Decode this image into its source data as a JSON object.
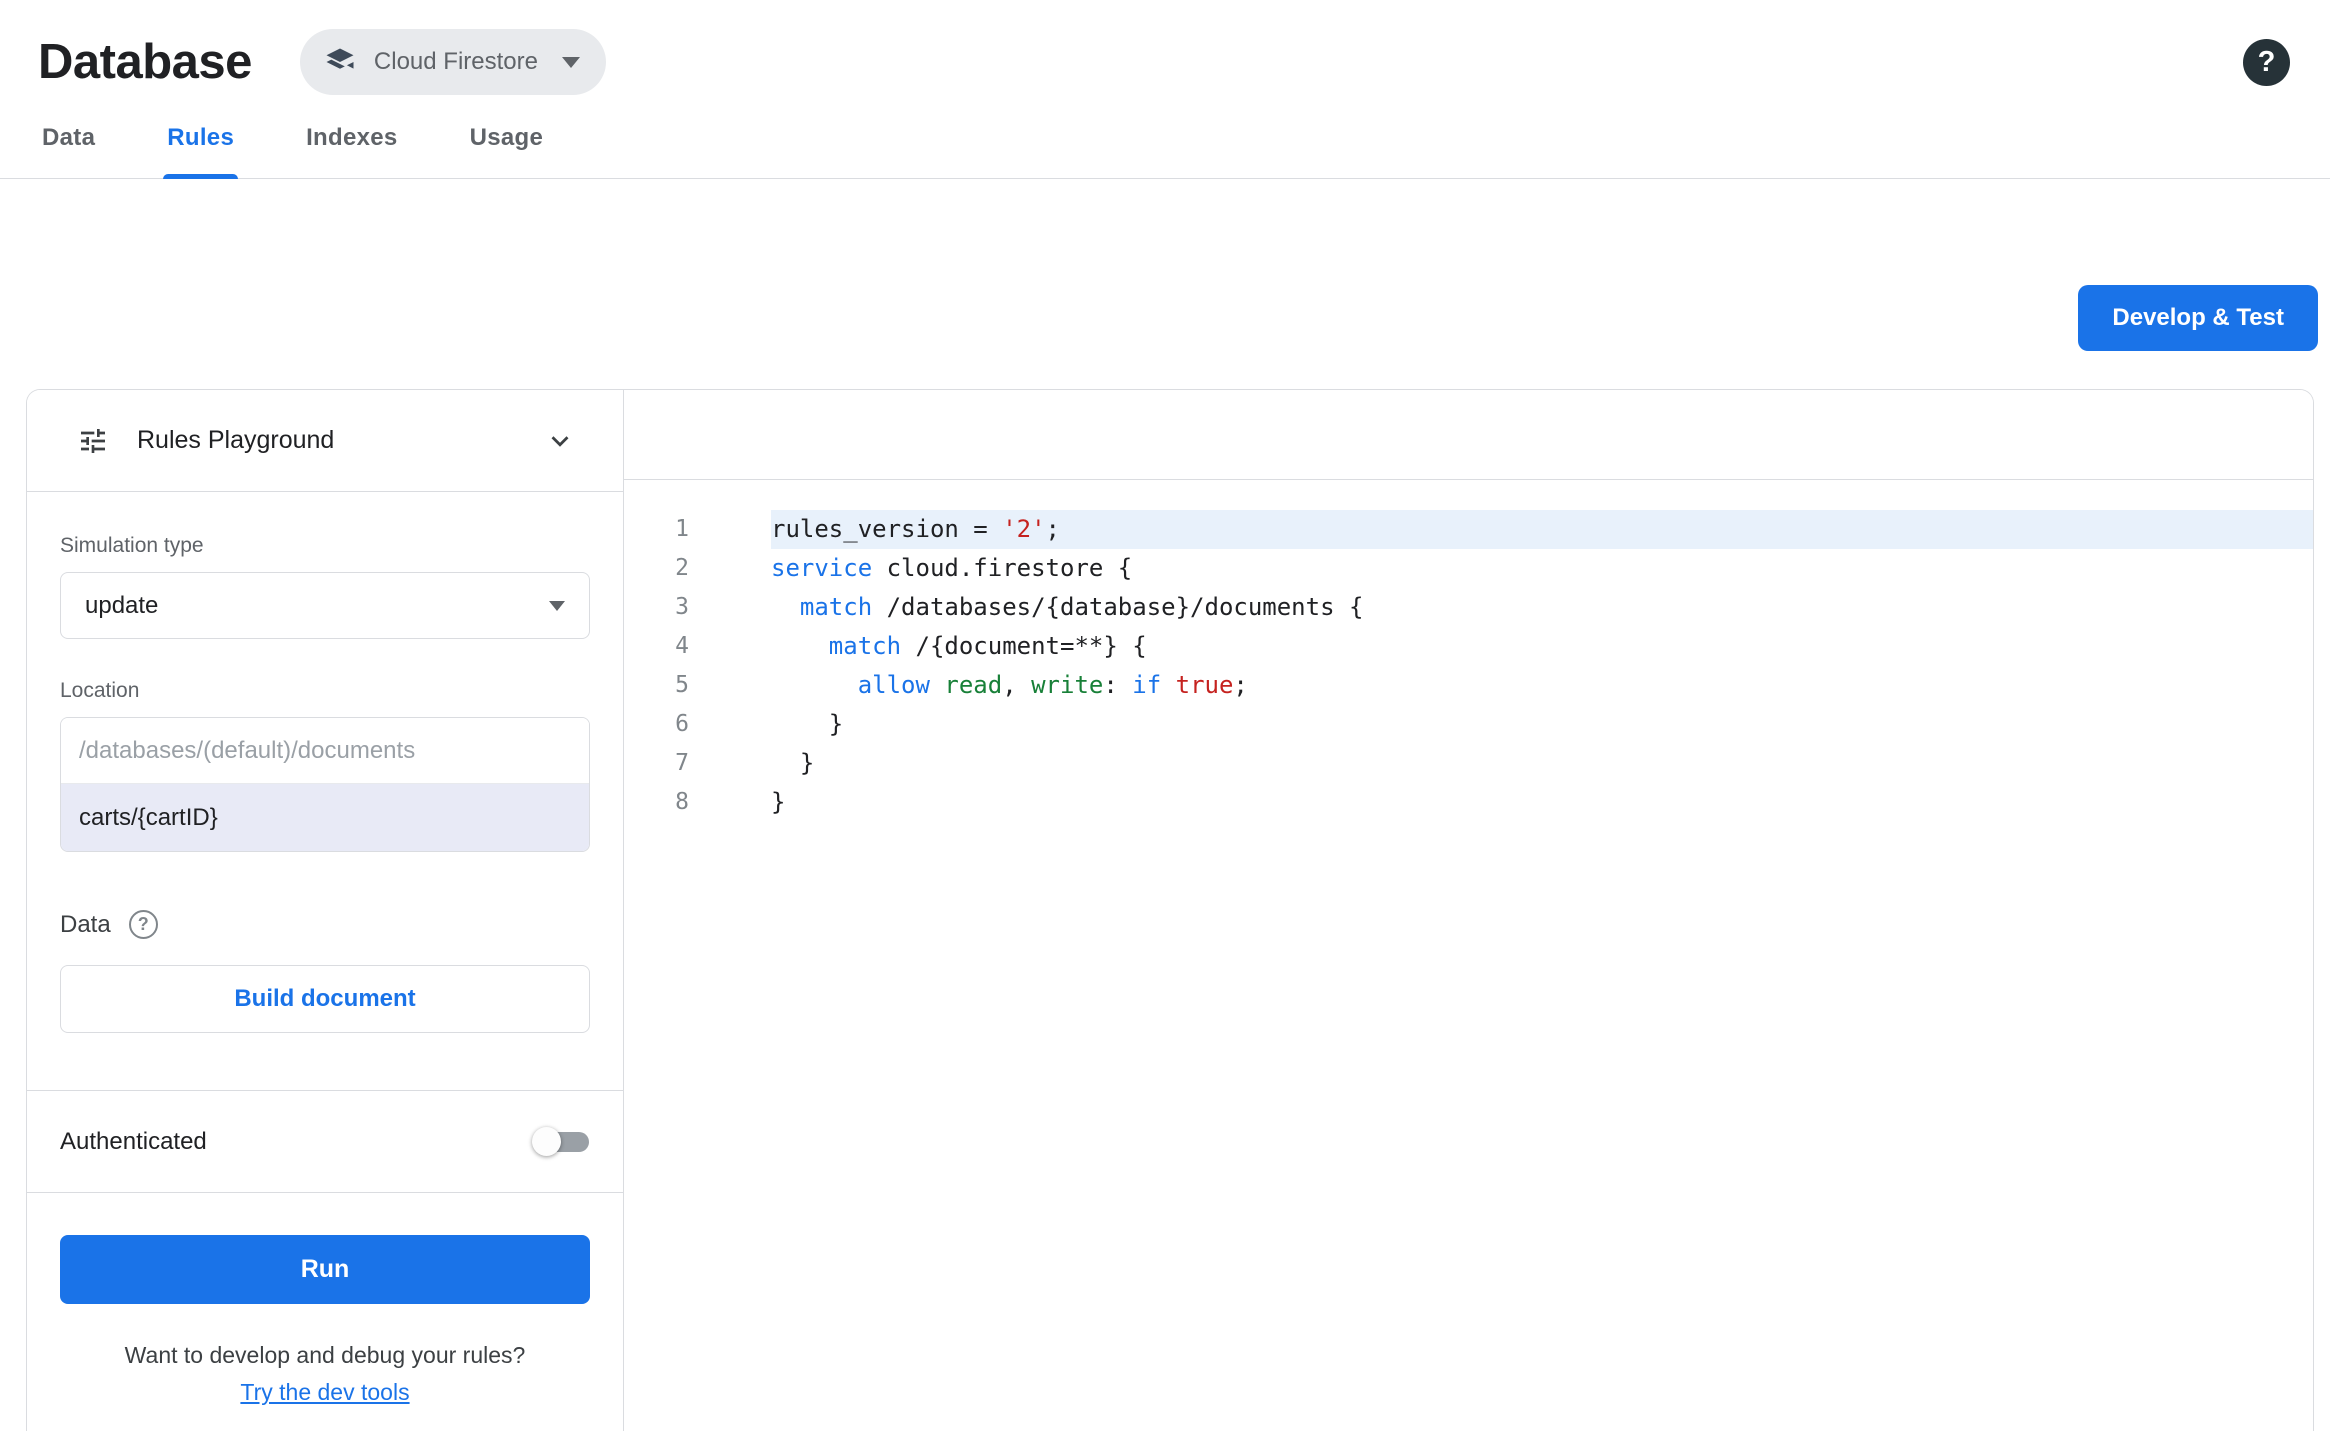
{
  "header": {
    "title": "Database",
    "product": "Cloud Firestore",
    "help_label": "?"
  },
  "tabs": [
    {
      "label": "Data"
    },
    {
      "label": "Rules"
    },
    {
      "label": "Indexes"
    },
    {
      "label": "Usage"
    }
  ],
  "active_tab": "Rules",
  "toolbar": {
    "develop_test_label": "Develop & Test"
  },
  "playground": {
    "title": "Rules Playground",
    "simulation_type_label": "Simulation type",
    "simulation_type_value": "update",
    "location_label": "Location",
    "location_placeholder": "/databases/(default)/documents",
    "location_value": "carts/{cartID}",
    "data_label": "Data",
    "data_help_glyph": "?",
    "build_document_label": "Build document",
    "authenticated_label": "Authenticated",
    "authenticated_enabled": false,
    "run_label": "Run",
    "devtools_question": "Want to develop and debug your rules?",
    "devtools_link": "Try the dev tools"
  },
  "editor": {
    "token_colors": {
      "def": "#202124",
      "kw": "#1a73e8",
      "str": "#c5221f",
      "prop": "#188038"
    },
    "active_line": 1,
    "lines": [
      {
        "number": 1,
        "tokens": [
          [
            "def",
            "rules_version = "
          ],
          [
            "str",
            "'2'"
          ],
          [
            "def",
            ";"
          ]
        ]
      },
      {
        "number": 2,
        "tokens": [
          [
            "kw",
            "service"
          ],
          [
            "def",
            " cloud.firestore {"
          ]
        ]
      },
      {
        "number": 3,
        "tokens": [
          [
            "def",
            "  "
          ],
          [
            "kw",
            "match"
          ],
          [
            "def",
            " /databases/{database}/documents {"
          ]
        ]
      },
      {
        "number": 4,
        "tokens": [
          [
            "def",
            "    "
          ],
          [
            "kw",
            "match"
          ],
          [
            "def",
            " /{document=**} {"
          ]
        ]
      },
      {
        "number": 5,
        "tokens": [
          [
            "def",
            "      "
          ],
          [
            "kw",
            "allow"
          ],
          [
            "def",
            " "
          ],
          [
            "prop",
            "read"
          ],
          [
            "def",
            ", "
          ],
          [
            "prop",
            "write"
          ],
          [
            "def",
            ": "
          ],
          [
            "kw",
            "if"
          ],
          [
            "def",
            " "
          ],
          [
            "str",
            "true"
          ],
          [
            "def",
            ";"
          ]
        ]
      },
      {
        "number": 6,
        "tokens": [
          [
            "def",
            "    }"
          ]
        ]
      },
      {
        "number": 7,
        "tokens": [
          [
            "def",
            "  }"
          ]
        ]
      },
      {
        "number": 8,
        "tokens": [
          [
            "def",
            "}"
          ]
        ]
      }
    ]
  },
  "colors": {
    "accent": "#1a73e8",
    "active_line_bg": "#e8f1fb",
    "panel_border": "#dadce0"
  }
}
